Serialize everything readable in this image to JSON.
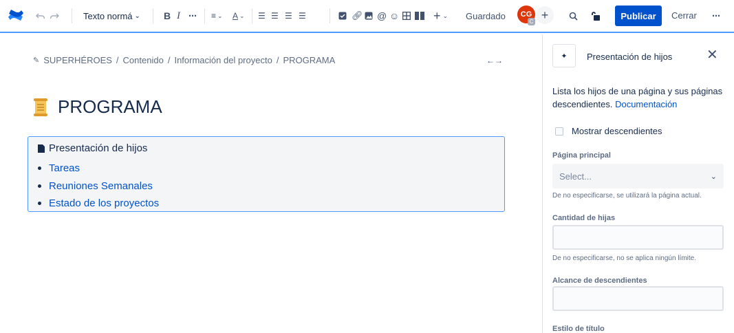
{
  "toolbar": {
    "text_style_label": "Texto normá",
    "saved_label": "Guardado",
    "avatar_initials": "CG",
    "avatar_badge": "C",
    "publish_label": "Publicar",
    "close_label": "Cerrar"
  },
  "breadcrumb": {
    "items": [
      "SUPERHÉROES",
      "Contenido",
      "Información del proyecto",
      "PROGRAMA"
    ],
    "separator": "/"
  },
  "page": {
    "title": "PROGRAMA"
  },
  "macro": {
    "heading": "Presentación de hijos",
    "children": [
      "Tareas",
      "Reuniones Semanales",
      "Estado de los proyectos"
    ]
  },
  "panel": {
    "title": "Presentación de hijos",
    "description": "Lista los hijos de una página y sus páginas descendientes.",
    "doc_link": "Documentación",
    "show_descendants_label": "Mostrar descendientes",
    "show_descendants_checked": false,
    "parent_page_label": "Página principal",
    "parent_page_placeholder": "Select...",
    "parent_page_helper": "De no especificarse, se utilizará la página actual.",
    "child_count_label": "Cantidad de hijas",
    "child_count_value": "",
    "child_count_helper": "De no especificarse, no se aplica ningún límite.",
    "depth_label": "Alcance de descendientes",
    "depth_value": "",
    "heading_style_label": "Estilo de título"
  },
  "colors": {
    "accent": "#0052cc",
    "focus_border": "#4c9aff",
    "avatar": "#de350b",
    "link": "#0052cc"
  }
}
